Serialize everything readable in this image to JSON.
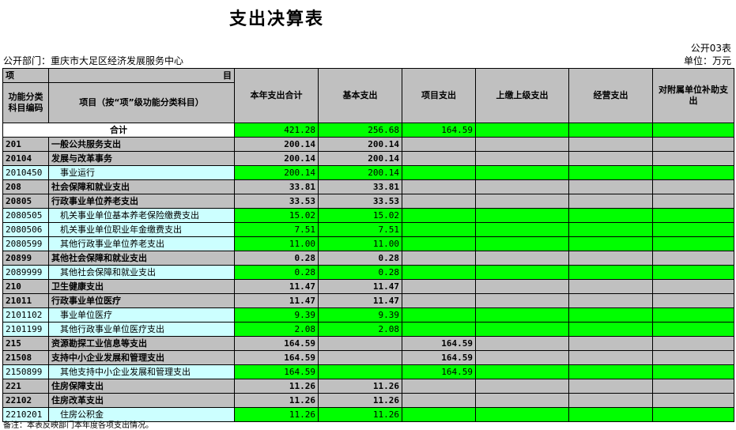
{
  "title": "支出决算表",
  "form_no": "公开03表",
  "department": "公开部门：重庆市大足区经济发展服务中心",
  "unit": "单位：万元",
  "header": {
    "xiang": "项",
    "mu": "目",
    "code": "功能分类科目编码",
    "item": "项目（按“项”级功能分类科目）",
    "cols": [
      "本年支出合计",
      "基本支出",
      "项目支出",
      "上缴上级支出",
      "经营支出",
      "对附属单位补助支出"
    ]
  },
  "total": {
    "label": "合计",
    "values": [
      "421.28",
      "256.68",
      "164.59",
      "",
      "",
      ""
    ]
  },
  "rows": [
    {
      "code": "201",
      "name": "一般公共服务支出",
      "level": "class",
      "values": [
        "200.14",
        "200.14",
        "",
        "",
        "",
        ""
      ]
    },
    {
      "code": "20104",
      "name": "发展与改革事务",
      "level": "class",
      "values": [
        "200.14",
        "200.14",
        "",
        "",
        "",
        ""
      ]
    },
    {
      "code": "2010450",
      "name": "事业运行",
      "level": "item",
      "values": [
        "200.14",
        "200.14",
        "",
        "",
        "",
        ""
      ]
    },
    {
      "code": "208",
      "name": "社会保障和就业支出",
      "level": "class",
      "values": [
        "33.81",
        "33.81",
        "",
        "",
        "",
        ""
      ]
    },
    {
      "code": "20805",
      "name": "行政事业单位养老支出",
      "level": "class",
      "values": [
        "33.53",
        "33.53",
        "",
        "",
        "",
        ""
      ]
    },
    {
      "code": "2080505",
      "name": "机关事业单位基本养老保险缴费支出",
      "level": "item",
      "values": [
        "15.02",
        "15.02",
        "",
        "",
        "",
        ""
      ]
    },
    {
      "code": "2080506",
      "name": "机关事业单位职业年金缴费支出",
      "level": "item",
      "values": [
        "7.51",
        "7.51",
        "",
        "",
        "",
        ""
      ]
    },
    {
      "code": "2080599",
      "name": "其他行政事业单位养老支出",
      "level": "item",
      "values": [
        "11.00",
        "11.00",
        "",
        "",
        "",
        ""
      ]
    },
    {
      "code": "20899",
      "name": "其他社会保障和就业支出",
      "level": "class",
      "values": [
        "0.28",
        "0.28",
        "",
        "",
        "",
        ""
      ]
    },
    {
      "code": "2089999",
      "name": "其他社会保障和就业支出",
      "level": "item",
      "values": [
        "0.28",
        "0.28",
        "",
        "",
        "",
        ""
      ]
    },
    {
      "code": "210",
      "name": "卫生健康支出",
      "level": "class",
      "values": [
        "11.47",
        "11.47",
        "",
        "",
        "",
        ""
      ]
    },
    {
      "code": "21011",
      "name": "行政事业单位医疗",
      "level": "class",
      "values": [
        "11.47",
        "11.47",
        "",
        "",
        "",
        ""
      ]
    },
    {
      "code": "2101102",
      "name": "事业单位医疗",
      "level": "item",
      "values": [
        "9.39",
        "9.39",
        "",
        "",
        "",
        ""
      ]
    },
    {
      "code": "2101199",
      "name": "其他行政事业单位医疗支出",
      "level": "item",
      "values": [
        "2.08",
        "2.08",
        "",
        "",
        "",
        ""
      ]
    },
    {
      "code": "215",
      "name": "资源勘探工业信息等支出",
      "level": "class",
      "values": [
        "164.59",
        "",
        "164.59",
        "",
        "",
        ""
      ]
    },
    {
      "code": "21508",
      "name": "支持中小企业发展和管理支出",
      "level": "class",
      "values": [
        "164.59",
        "",
        "164.59",
        "",
        "",
        ""
      ]
    },
    {
      "code": "2150899",
      "name": "其他支持中小企业发展和管理支出",
      "level": "item",
      "values": [
        "164.59",
        "",
        "164.59",
        "",
        "",
        ""
      ]
    },
    {
      "code": "221",
      "name": "住房保障支出",
      "level": "class",
      "values": [
        "11.26",
        "11.26",
        "",
        "",
        "",
        ""
      ]
    },
    {
      "code": "22102",
      "name": "住房改革支出",
      "level": "class",
      "values": [
        "11.26",
        "11.26",
        "",
        "",
        "",
        ""
      ]
    },
    {
      "code": "2210201",
      "name": "住房公积金",
      "level": "item",
      "values": [
        "11.26",
        "11.26",
        "",
        "",
        "",
        ""
      ]
    }
  ],
  "note": "备注：本表反映部门本年度各项支出情况。",
  "colors": {
    "header_gray": "#c0c0c0",
    "data_green": "#00ff00",
    "item_cyan": "#ccffff"
  }
}
